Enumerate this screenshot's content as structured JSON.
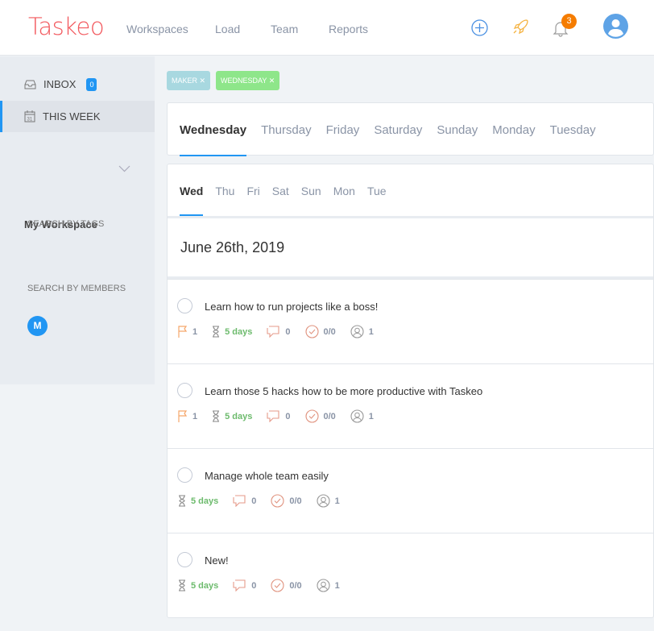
{
  "header": {
    "logo": "Taskeo",
    "nav": [
      "Workspaces",
      "Load",
      "Team",
      "Reports"
    ],
    "notifications": "3"
  },
  "sidebar": {
    "inbox": "INBOX",
    "inbox_count": "0",
    "this_week": "THIS WEEK",
    "workspace": "My Workspace",
    "search_tags": "SEARCH BY TAGS",
    "search_members": "SEARCH BY MEMBERS",
    "member_initial": "M"
  },
  "tags": [
    {
      "label": "MAKER",
      "color": "#a8d8e0"
    },
    {
      "label": "WEDNESDAY",
      "color": "#8ee68a"
    }
  ],
  "days_long": [
    "Wednesday",
    "Thursday",
    "Friday",
    "Saturday",
    "Sunday",
    "Monday",
    "Tuesday"
  ],
  "days_short": [
    "Wed",
    "Thu",
    "Fri",
    "Sat",
    "Sun",
    "Mon",
    "Tue"
  ],
  "date": "June 26th, 2019",
  "tasks": [
    {
      "title": "Learn how to run projects like a boss!",
      "flag": "1",
      "duration": "5 days",
      "comments": "0",
      "checklist": "0/0",
      "members": "1"
    },
    {
      "title": "Learn those 5 hacks how to be more productive with Taskeo",
      "flag": "1",
      "duration": "5 days",
      "comments": "0",
      "checklist": "0/0",
      "members": "1"
    },
    {
      "title": "Manage whole team easily",
      "duration": "5 days",
      "comments": "0",
      "checklist": "0/0",
      "members": "1"
    },
    {
      "title": "New!",
      "duration": "5 days",
      "comments": "0",
      "checklist": "0/0",
      "members": "1"
    }
  ]
}
